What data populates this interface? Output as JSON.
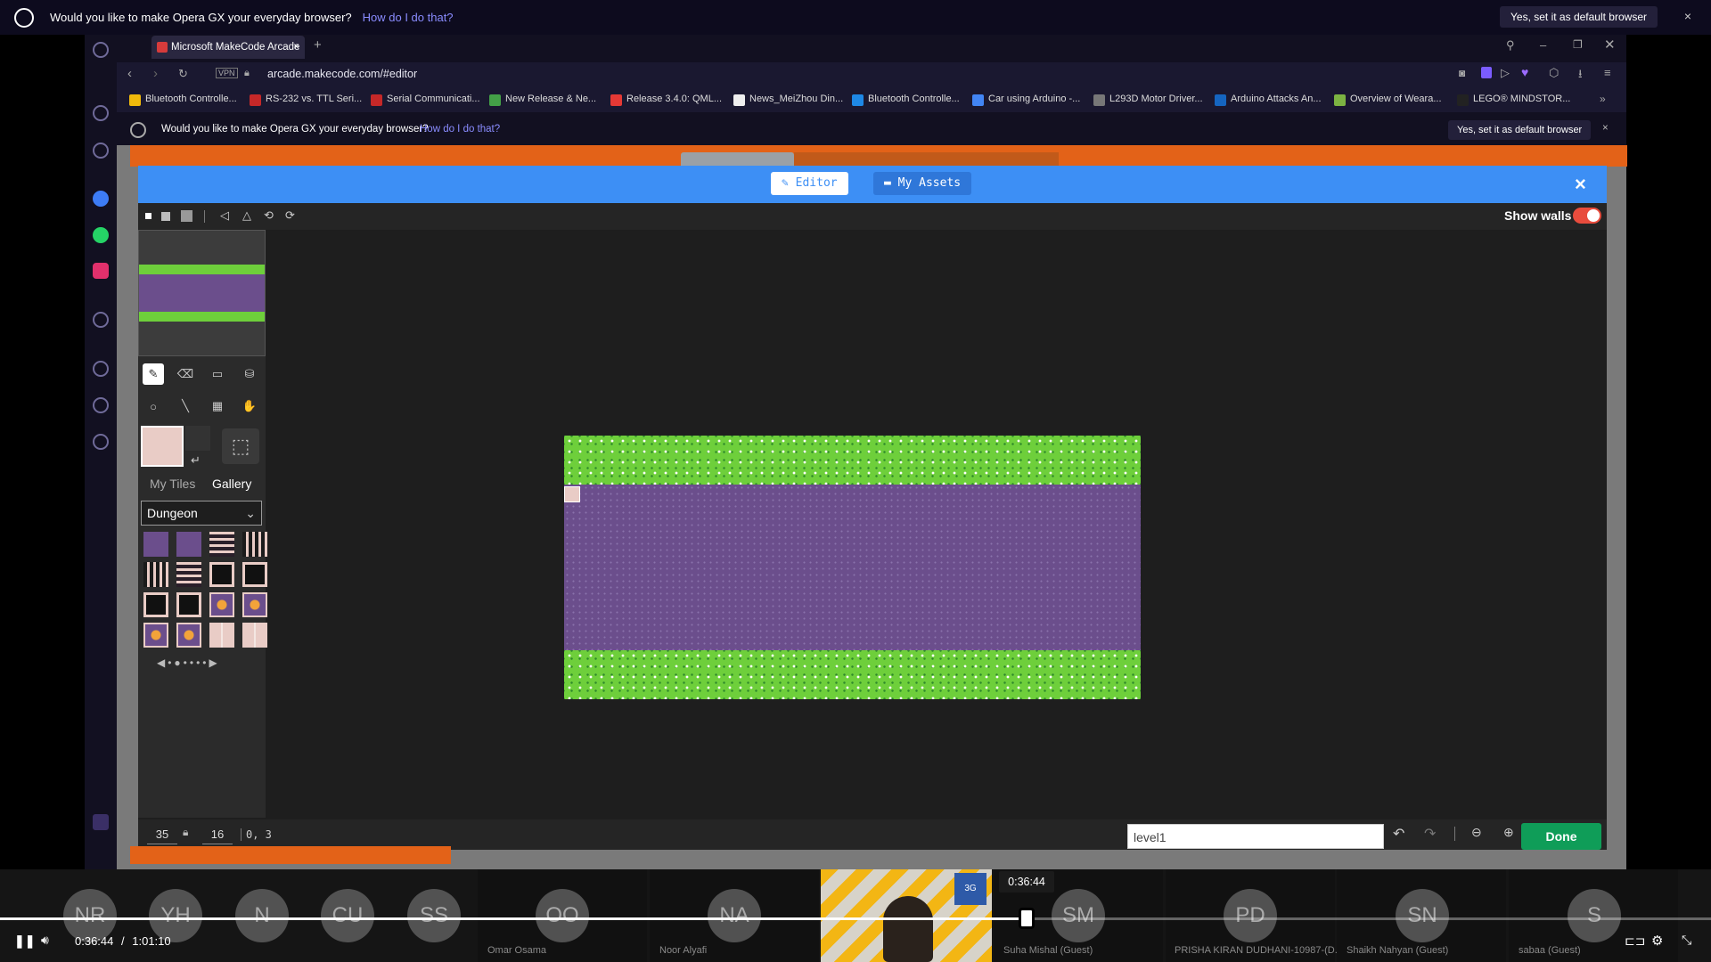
{
  "outer_banner": {
    "text": "Would you like to make Opera GX your everyday browser?",
    "link": "How do I do that?",
    "button": "Yes, set it as default browser",
    "close": "×"
  },
  "tabs": [
    {
      "label": "Microsoft MakeCode Arcade",
      "close": "×"
    }
  ],
  "new_tab": "+",
  "address": {
    "vpn": "VPN",
    "url": "arcade.makecode.com/#editor"
  },
  "bookmarks": [
    {
      "label": "Bluetooth Controlle...",
      "color": "#f0b90b"
    },
    {
      "label": "RS-232 vs. TTL Seri...",
      "color": "#c62828"
    },
    {
      "label": "Serial Communicati...",
      "color": "#c62828"
    },
    {
      "label": "New Release & Ne...",
      "color": "#43a047"
    },
    {
      "label": "Release 3.4.0: QML...",
      "color": "#e53935"
    },
    {
      "label": "News_MeiZhou Din...",
      "color": "#eeeeee"
    },
    {
      "label": "Bluetooth Controlle...",
      "color": "#1e88e5"
    },
    {
      "label": "Car using Arduino -...",
      "color": "#4285f4"
    },
    {
      "label": "L293D Motor Driver...",
      "color": "#777777"
    },
    {
      "label": "Arduino Attacks An...",
      "color": "#1565c0"
    },
    {
      "label": "Overview of Weara...",
      "color": "#7cb342"
    },
    {
      "label": "LEGO® MINDSTOR...",
      "color": "#222222"
    }
  ],
  "bookmarks_more": "»",
  "inner_banner": {
    "text": "Would you like to make Opera GX your everyday browser?",
    "link": "How do I do that?",
    "button": "Yes, set it as default browser",
    "close": "×"
  },
  "editor": {
    "tab_editor": "Editor",
    "tab_assets": "My Assets",
    "close": "×",
    "show_walls_label": "Show walls",
    "show_walls_on": true,
    "tile_tabs": {
      "my_tiles": "My Tiles",
      "gallery": "Gallery"
    },
    "category": "Dungeon",
    "width": "35",
    "height": "16",
    "cursor_pos": "0, 3",
    "level_name": "level1",
    "done": "Done"
  },
  "participants": [
    {
      "initials": "NR",
      "name": ""
    },
    {
      "initials": "YH",
      "name": ""
    },
    {
      "initials": "N",
      "name": ""
    },
    {
      "initials": "CU",
      "name": ""
    },
    {
      "initials": "SS",
      "name": ""
    },
    {
      "initials": "OO",
      "name": "Omar Osama"
    },
    {
      "initials": "NA",
      "name": "Noor Alyafi"
    },
    {
      "initials": "SM",
      "name": "Suha Mishal (Guest)"
    },
    {
      "initials": "PD",
      "name": "PRISHA KIRAN DUDHANI-10987-(D..."
    },
    {
      "initials": "SN",
      "name": "Shaikh Nahyan (Guest)"
    },
    {
      "initials": "S",
      "name": "sabaa (Guest)"
    }
  ],
  "player": {
    "current_time": "0:36:44",
    "separator": "/",
    "duration": "1:01:10",
    "hover_time": "0:36:44",
    "progress": 0.6
  }
}
